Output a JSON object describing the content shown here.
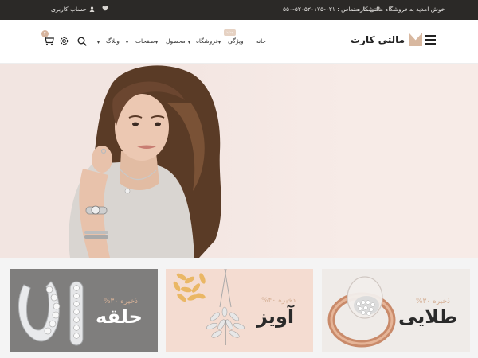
{
  "topbar": {
    "welcome": "خوش آمدید به فروشگاه مالتی کارت",
    "phone": "شماره تماس : ۰۲۱-۵۲۰۵۲۰۱۷۵-۵۵۰",
    "account": "حساب کاربری"
  },
  "header": {
    "logo_text": "مالتی کارت",
    "cart_count": "۴",
    "nav": {
      "home": "خانه",
      "features": "ویژگی",
      "features_badge": "جدید",
      "shop": "فروشگاه",
      "product": "محصول",
      "pages": "صفحات",
      "blog": "وبلاگ"
    }
  },
  "banners": [
    {
      "save": "%۳۰ ذخیره",
      "title": "طلایی"
    },
    {
      "save": "%۴۰ ذخیره",
      "title": "آویز"
    },
    {
      "save": "%۳۰ ذخیره",
      "title": "حلقه"
    }
  ],
  "colors": {
    "topbar_bg": "#2b2927",
    "accent": "#d6b49e",
    "hero_bg": "#f2e5e1"
  }
}
